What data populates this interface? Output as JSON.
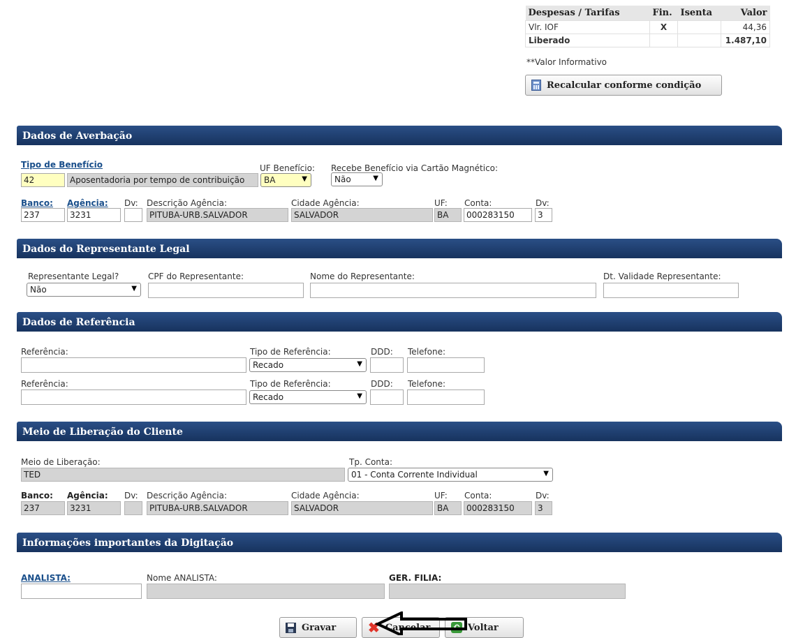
{
  "fees": {
    "headers": [
      "Despesas / Tarifas",
      "Fin.",
      "Isenta",
      "Valor"
    ],
    "rows": [
      {
        "name": "Vlr. IOF",
        "fin": "X",
        "isenta": "",
        "valor": "44,36"
      },
      {
        "name": "Liberado",
        "fin": "",
        "isenta": "",
        "valor": "1.487,10"
      }
    ],
    "note": "**Valor Informativo",
    "recalc_label": "Recalcular conforme condição"
  },
  "averbacao": {
    "title": "Dados de Averbação",
    "tipo_beneficio_label": "Tipo de Benefício",
    "tipo_beneficio_code": "42",
    "tipo_beneficio_desc": "Aposentadoria por tempo de contribuição",
    "uf_beneficio_label": "UF Benefício:",
    "uf_beneficio_value": "BA",
    "cartao_label": "Recebe Benefício via Cartão Magnético:",
    "cartao_value": "Não",
    "banco_label": "Banco:",
    "agencia_label": "Agência:",
    "dv_label": "Dv:",
    "desc_agencia_label": "Descrição Agência:",
    "cidade_label": "Cidade Agência:",
    "uf_label": "UF:",
    "conta_label": "Conta:",
    "conta_dv_label": "Dv:",
    "banco": "237",
    "agencia": "3231",
    "dv": "",
    "desc_agencia": "PITUBA-URB.SALVADOR",
    "cidade": "SALVADOR",
    "uf": "BA",
    "conta": "000283150",
    "conta_dv": "3"
  },
  "representante": {
    "title": "Dados do Representante Legal",
    "legal_label": "Representante Legal?",
    "legal_value": "Não",
    "cpf_label": "CPF do Representante:",
    "nome_label": "Nome do Representante:",
    "validade_label": "Dt. Validade Representante:"
  },
  "referencia": {
    "title": "Dados de Referência",
    "rows": [
      {
        "ref_label": "Referência:",
        "tipo_label": "Tipo de Referência:",
        "tipo_value": "Recado",
        "ddd_label": "DDD:",
        "tel_label": "Telefone:"
      },
      {
        "ref_label": "Referência:",
        "tipo_label": "Tipo de Referência:",
        "tipo_value": "Recado",
        "ddd_label": "DDD:",
        "tel_label": "Telefone:"
      }
    ]
  },
  "liberacao": {
    "title": "Meio de Liberação do Cliente",
    "meio_label": "Meio de Liberação:",
    "meio_value": "TED",
    "tp_conta_label": "Tp. Conta:",
    "tp_conta_value": "01 - Conta Corrente Individual",
    "banco_label": "Banco:",
    "agencia_label": "Agência:",
    "dv_label": "Dv:",
    "desc_agencia_label": "Descrição Agência:",
    "cidade_label": "Cidade Agência:",
    "uf_label": "UF:",
    "conta_label": "Conta:",
    "conta_dv_label": "Dv:",
    "banco": "237",
    "agencia": "3231",
    "dv": "",
    "desc_agencia": "PITUBA-URB.SALVADOR",
    "cidade": "SALVADOR",
    "uf": "BA",
    "conta": "000283150",
    "conta_dv": "3"
  },
  "digitacao": {
    "title": "Informações importantes da Digitação",
    "analista_label": "ANALISTA:",
    "nome_analista_label": "Nome ANALISTA:",
    "ger_filia_label": "GER. FILIA:"
  },
  "actions": {
    "gravar": "Gravar",
    "cancelar": "Cancelar",
    "voltar": "Voltar"
  },
  "colors": {
    "section_bar": "#17335e",
    "link": "#1a4f8b",
    "readonly_bg": "#d4d4d4",
    "highlight_bg": "#ffffc0"
  }
}
